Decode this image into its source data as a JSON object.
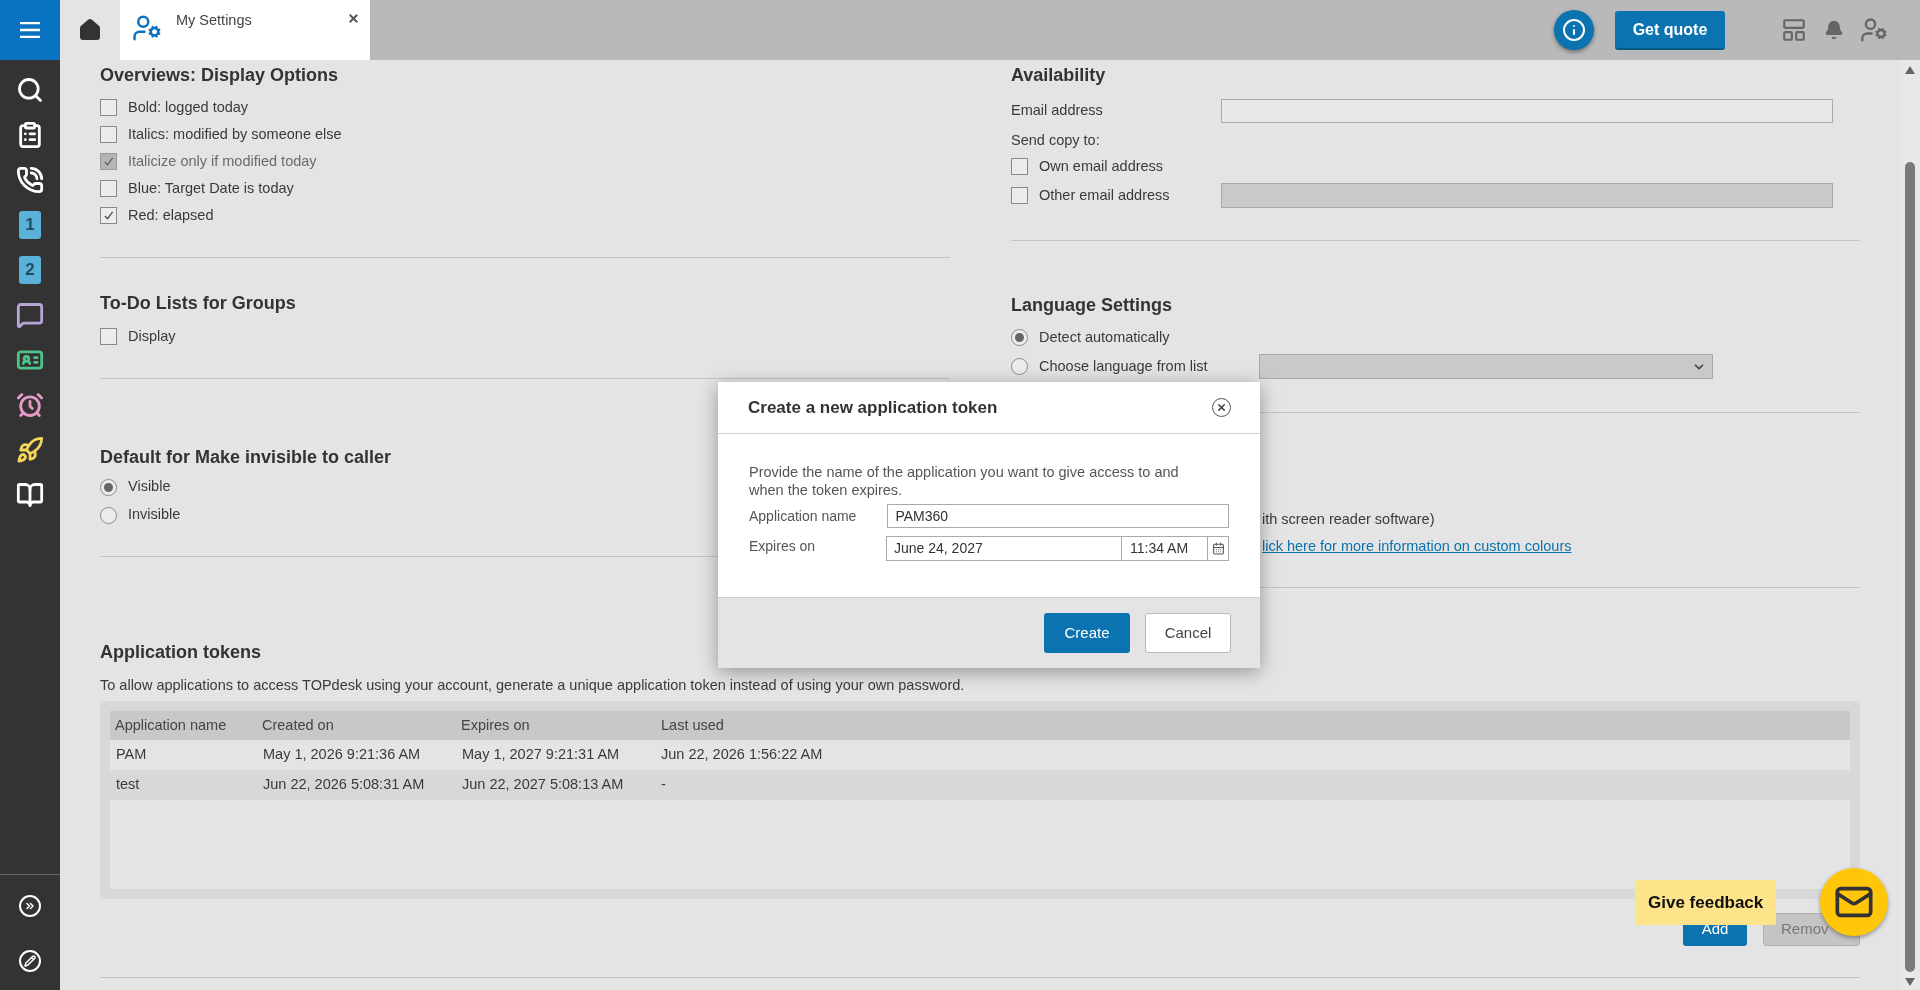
{
  "sidebar": {
    "items": [
      {
        "kind": "search"
      },
      {
        "kind": "clipboard"
      },
      {
        "kind": "phone"
      },
      {
        "kind": "badge",
        "text": "1",
        "color": "#5bb2d9"
      },
      {
        "kind": "badge",
        "text": "2",
        "color": "#5bb2d9"
      },
      {
        "kind": "chat"
      },
      {
        "kind": "id_card"
      },
      {
        "kind": "clock"
      },
      {
        "kind": "rocket"
      },
      {
        "kind": "book"
      }
    ],
    "footer_items": [
      {
        "kind": "expand"
      },
      {
        "kind": "edit"
      }
    ]
  },
  "tabs": [
    {
      "kind": "home",
      "selected": false
    },
    {
      "kind": "page",
      "label": "My Settings",
      "selected": true
    }
  ],
  "header": {
    "get_quote": "Get quote"
  },
  "display_options": {
    "title": "Overviews: Display Options",
    "options": [
      {
        "label": "Bold: logged today",
        "checked": false,
        "disabled": false
      },
      {
        "label": "Italics: modified by someone else",
        "checked": false,
        "disabled": false
      },
      {
        "label": "Italicize only if modified today",
        "checked": true,
        "disabled": true
      },
      {
        "label": "Blue: Target Date is today",
        "checked": false,
        "disabled": false
      },
      {
        "label": "Red: elapsed",
        "checked": true,
        "disabled": false
      }
    ]
  },
  "todo_groups": {
    "title": "To-Do Lists for Groups",
    "options": [
      {
        "label": "Display",
        "checked": false,
        "disabled": false
      }
    ]
  },
  "invisible_default": {
    "title": "Default for Make invisible to caller",
    "options": [
      {
        "label": "Visible",
        "selected": true
      },
      {
        "label": "Invisible",
        "selected": false
      }
    ]
  },
  "availability": {
    "title": "Availability",
    "email_label": "Email address",
    "send_copy_label": "Send copy to:",
    "copy_options": [
      {
        "label": "Own email address",
        "checked": false
      },
      {
        "label": "Other email address",
        "checked": false,
        "field": {
          "disabled": true
        }
      }
    ]
  },
  "language": {
    "title": "Language Settings",
    "options": [
      {
        "label": "Detect automatically",
        "selected": true
      },
      {
        "label": "Choose language from list",
        "selected": false,
        "select": {
          "disabled": true
        }
      }
    ]
  },
  "accessibility": {
    "note": "ith screen reader software)",
    "link": "lick here for more information on custom colours"
  },
  "tokens": {
    "title": "Application tokens",
    "description": "To allow applications to access TOPdesk using your account, generate a unique application token instead of using your own password.",
    "columns": [
      "Application name",
      "Created on",
      "Expires on",
      "Last used"
    ],
    "rows": [
      [
        "PAM",
        "May 1, 2026 9:21:36 AM",
        "May 1, 2027 9:21:31 AM",
        "Jun 22, 2026 1:56:22 AM"
      ],
      [
        "test",
        "Jun 22, 2026 5:08:31 AM",
        "Jun 22, 2027 5:08:13 AM",
        "-"
      ]
    ],
    "add": "Add",
    "remove": "Remov"
  },
  "dialog": {
    "title": "Create a new application token",
    "description": "Provide the name of the application you want to give access to and when the token expires.",
    "name_label": "Application name",
    "name_value": "PAM360",
    "expires_label": "Expires on",
    "date": "June 24, 2027",
    "time": "11:34 AM",
    "create": "Create",
    "cancel": "Cancel"
  },
  "feedback": {
    "label": "Give feedback"
  }
}
